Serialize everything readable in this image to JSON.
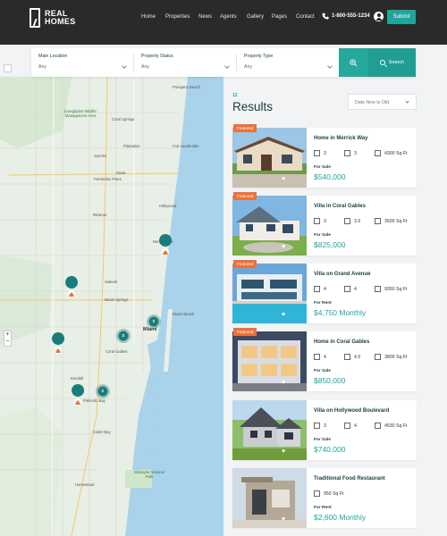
{
  "brand": {
    "line1": "REAL",
    "line2": "HOMES"
  },
  "nav": [
    {
      "label": "Home"
    },
    {
      "label": "Properties"
    },
    {
      "label": "News"
    },
    {
      "label": "Agents"
    },
    {
      "label": "Gallery"
    },
    {
      "label": "Pages"
    },
    {
      "label": "Contact"
    }
  ],
  "phone": "1-800-555-1234",
  "submit_label": "Submit",
  "search": {
    "fields": [
      {
        "label": "Main Location",
        "value": "Any"
      },
      {
        "label": "Property Status",
        "value": "Any"
      },
      {
        "label": "Property Type",
        "value": "Any"
      }
    ],
    "button_label": "Search"
  },
  "results": {
    "count": "12",
    "title": "Results",
    "sort_value": "Date New to Old"
  },
  "map": {
    "labels": [
      "Pompano Beach",
      "Everglades Wildlife Management Area",
      "Coral Springs",
      "Plantation",
      "Fort Lauderdale",
      "Sunrise",
      "Davie",
      "Pembroke Pines",
      "Hollywood",
      "Miramar",
      "North Miami",
      "Hialeah",
      "Miami Springs",
      "Miami",
      "Miami Beach",
      "Coral Gables",
      "Kendall",
      "Palmetto Bay",
      "Cutler Bay",
      "Homestead",
      "Biscayne National Park"
    ],
    "cluster_counts": [
      "3",
      "3",
      "2"
    ]
  },
  "listings": [
    {
      "featured": "Featured",
      "title": "Home in Merrick Way",
      "beds": "3",
      "baths": "3",
      "area": "4300 Sq Ft",
      "status": "For Sale",
      "price": "$540,000"
    },
    {
      "featured": "Featured",
      "title": "Villa in Coral Gables",
      "beds": "3",
      "baths": "3.5",
      "area": "3500 Sq Ft",
      "status": "For Sale",
      "price": "$825,000"
    },
    {
      "featured": "Featured",
      "title": "Villa on Grand Avenue",
      "beds": "4",
      "baths": "4",
      "area": "9350 Sq Ft",
      "status": "For Rent",
      "price": "$4,750 Monthly"
    },
    {
      "featured": "Featured",
      "title": "Home in Coral Gables",
      "beds": "4",
      "baths": "4.5",
      "area": "3800 Sq Ft",
      "status": "For Sale",
      "price": "$850,000"
    },
    {
      "featured": "",
      "title": "Villa on Hollywood Boulevard",
      "beds": "3",
      "baths": "4",
      "area": "4530 Sq Ft",
      "status": "For Sale",
      "price": "$740,000"
    },
    {
      "featured": "",
      "title": "Traditional Food Restaurant",
      "beds": "",
      "baths": "",
      "area": "950 Sq Ft",
      "status": "For Rent",
      "price": "$2,600 Monthly"
    }
  ],
  "colors": {
    "accent": "#1ea69a",
    "header": "#2a2a2a",
    "featured": "#ea723d",
    "water": "#a9d3ea",
    "land": "#e8efe6"
  },
  "icons": [
    "logo-icon",
    "phone-icon",
    "user-icon",
    "filter-icon",
    "search-icon",
    "chevron-down-icon",
    "fullscreen-icon",
    "bed-icon",
    "bath-icon",
    "area-icon",
    "heart-icon",
    "share-icon",
    "map-marker-icon"
  ]
}
